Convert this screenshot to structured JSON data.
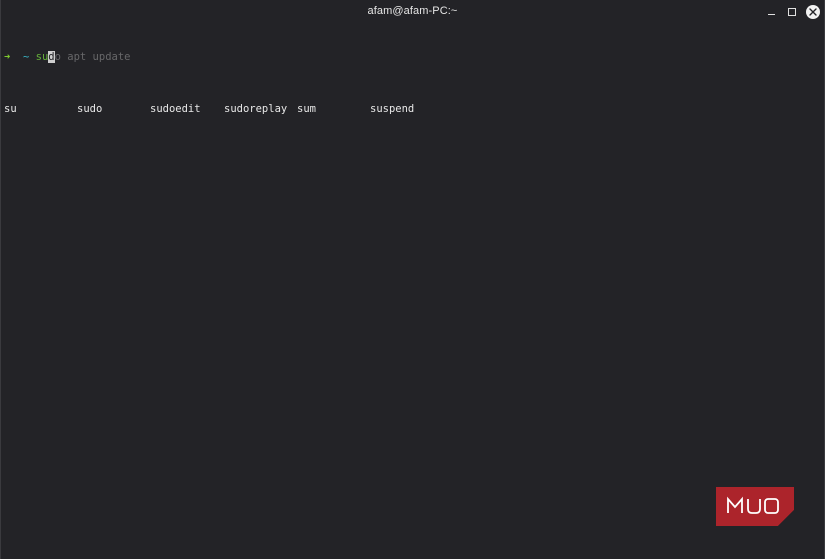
{
  "window": {
    "title": "afam@afam-PC:~"
  },
  "prompt": {
    "arrow": "➜",
    "cwd": "~",
    "typed_before_cursor": "su",
    "cursor_char": "d",
    "autosuggestion": "o apt update"
  },
  "completions": [
    "su",
    "sudo",
    "sudoedit",
    "sudoreplay",
    "sum",
    "suspend"
  ],
  "watermark": {
    "text": "MUO",
    "color": "#c0282d"
  },
  "colors": {
    "background": "#232327",
    "prompt_arrow": "#7ec92f",
    "prompt_cwd": "#39b6c7",
    "typed_command": "#66b33a",
    "autosuggestion": "#676769",
    "output_text": "#e8e8e8"
  },
  "icons": {
    "minimize": "minimize-icon",
    "maximize": "maximize-icon",
    "close": "close-icon"
  }
}
